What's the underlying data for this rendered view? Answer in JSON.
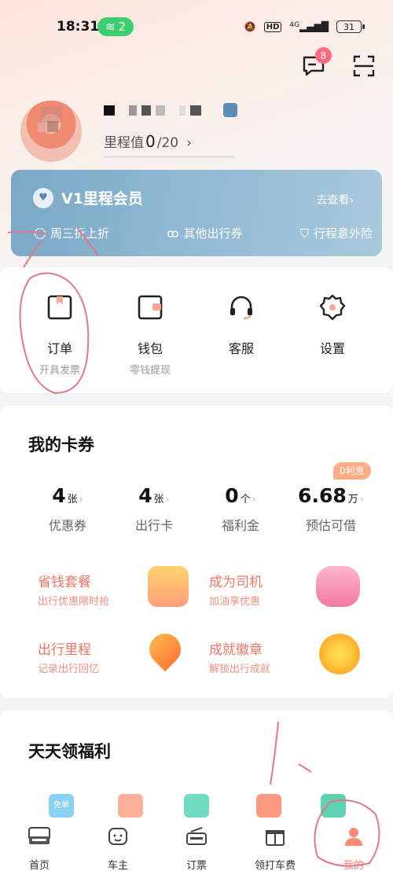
{
  "status_bar": {
    "time": "18:31",
    "hotspot_count": "2",
    "network": "4G",
    "hd": "HD",
    "battery": "31"
  },
  "header": {
    "message_badge": "8",
    "icons": [
      "message-icon",
      "scan-icon"
    ]
  },
  "profile": {
    "mileage_label": "里程值",
    "mileage_value": "0",
    "mileage_max": "/20",
    "chevron": "›"
  },
  "member_card": {
    "title": "V1里程会员",
    "link": "去查看",
    "chevron": "›",
    "benefits": [
      "周三折上折",
      "其他出行券",
      "行程意外险"
    ]
  },
  "quick_actions": [
    {
      "label": "订单",
      "sub": "开具发票",
      "icon": "order-icon"
    },
    {
      "label": "钱包",
      "sub": "零钱提现",
      "icon": "wallet-icon"
    },
    {
      "label": "客服",
      "sub": "",
      "icon": "headset-icon"
    },
    {
      "label": "设置",
      "sub": "",
      "icon": "gear-icon"
    }
  ],
  "cards": {
    "title": "我的卡券",
    "interest_badge": "0利息",
    "stats": [
      {
        "value": "4",
        "unit": "张",
        "label": "优惠券"
      },
      {
        "value": "4",
        "unit": "张",
        "label": "出行卡"
      },
      {
        "value": "0",
        "unit": "个",
        "label": "福利金"
      },
      {
        "value": "6.68",
        "unit": "万",
        "label": "预估可借"
      }
    ],
    "promos": [
      {
        "title": "省钱套餐",
        "sub": "出行优惠限时抢",
        "icon": "shopping-bag-icon"
      },
      {
        "title": "成为司机",
        "sub": "加油享优惠",
        "icon": "pink-car-icon"
      },
      {
        "title": "出行里程",
        "sub": "记录出行回忆",
        "icon": "location-pin-icon"
      },
      {
        "title": "成就徽章",
        "sub": "解锁出行成就",
        "icon": "badge-medal-icon"
      }
    ]
  },
  "welfare": {
    "title": "天天领福利",
    "coupon_tag": "免单"
  },
  "tabbar": [
    {
      "label": "首页",
      "icon": "home-car-icon",
      "active": false
    },
    {
      "label": "车主",
      "icon": "car-owner-icon",
      "active": false
    },
    {
      "label": "订票",
      "icon": "ticket-icon",
      "active": false
    },
    {
      "label": "领打车费",
      "icon": "gift-icon",
      "active": false
    },
    {
      "label": "我的",
      "icon": "profile-icon",
      "active": true
    }
  ],
  "colors": {
    "accent": "#ff7d6a",
    "member_blue": "#8fb8d3",
    "promo_text": "#ef7664",
    "badge": "#ff6b7c"
  }
}
